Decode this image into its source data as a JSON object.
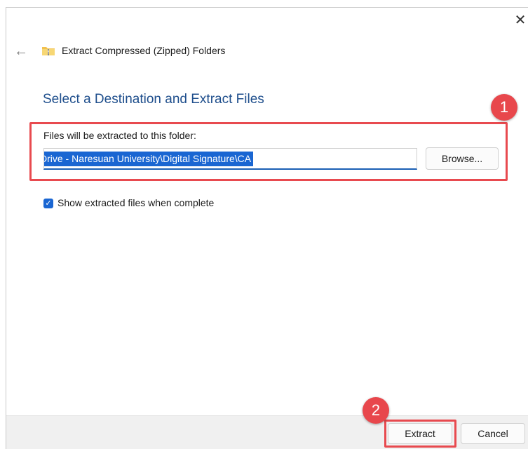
{
  "window": {
    "title": "Extract Compressed (Zipped) Folders",
    "close_glyph": "✕",
    "back_glyph": "←"
  },
  "main": {
    "heading": "Select a Destination and Extract Files",
    "destination_label": "Files will be extracted to this folder:",
    "destination_value": "Drive - Naresuan University\\Digital Signature\\CA",
    "destination_visible_text": "Drive - Naresuan University\\Digital Signature\\CA",
    "browse_label": "Browse...",
    "show_files_checkbox": {
      "label": "Show extracted files when complete",
      "checked": true
    }
  },
  "footer": {
    "extract_label": "Extract",
    "cancel_label": "Cancel"
  },
  "annotations": {
    "badge_1": "1",
    "badge_2": "2",
    "highlight_color": "#e84a4f"
  },
  "colors": {
    "accent": "#1a66d2",
    "heading": "#1e4e8c",
    "footer_bg": "#f0f0f0"
  },
  "icons": {
    "back": "arrow-left-icon",
    "folder": "zip-folder-icon",
    "close": "close-icon",
    "check": "checkmark-icon"
  }
}
